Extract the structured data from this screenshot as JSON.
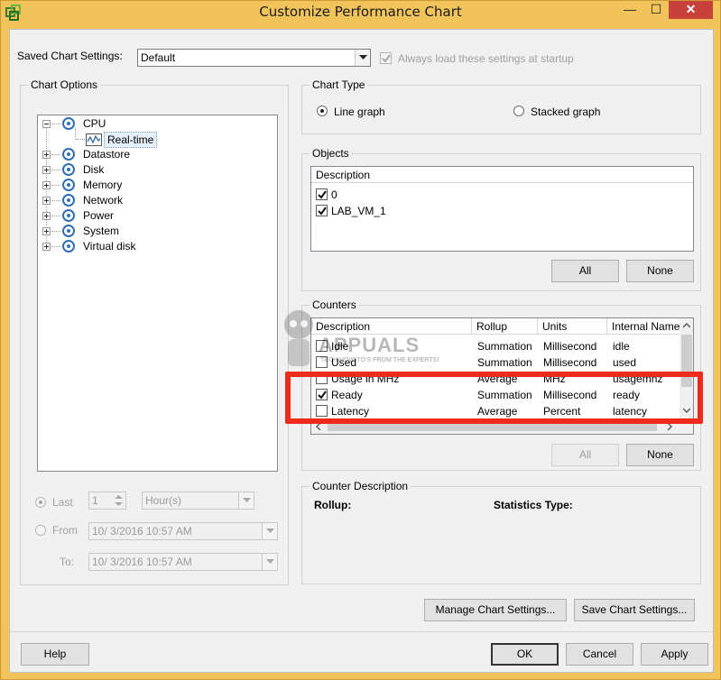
{
  "window": {
    "title": "Customize Performance Chart",
    "min_glyph": "—",
    "max_glyph": "☐",
    "close_glyph": "✕"
  },
  "saved_settings": {
    "label": "Saved Chart Settings:",
    "value": "Default",
    "always_load_label": "Always load these settings at startup",
    "always_load_checked": true
  },
  "chart_options": {
    "title": "Chart Options",
    "tree": [
      {
        "label": "CPU",
        "expanded": true
      },
      {
        "label": "Real-time",
        "child": true,
        "selected": true
      },
      {
        "label": "Datastore"
      },
      {
        "label": "Disk"
      },
      {
        "label": "Memory"
      },
      {
        "label": "Network"
      },
      {
        "label": "Power"
      },
      {
        "label": "System"
      },
      {
        "label": "Virtual disk"
      }
    ],
    "timespan": {
      "last_label": "Last",
      "last_value": "1",
      "last_unit": "Hour(s)",
      "from_label": "From",
      "from_value": "10/  3/2016 10:57 AM",
      "to_label": "To:",
      "to_value": "10/  3/2016 10:57 AM"
    }
  },
  "chart_type": {
    "title": "Chart Type",
    "line_label": "Line graph",
    "stacked_label": "Stacked graph",
    "selected": "line"
  },
  "objects": {
    "title": "Objects",
    "header": "Description",
    "items": [
      {
        "label": "0",
        "checked": true
      },
      {
        "label": "LAB_VM_1",
        "checked": true
      }
    ],
    "all_label": "All",
    "none_label": "None"
  },
  "counters": {
    "title": "Counters",
    "columns": [
      "Description",
      "Rollup",
      "Units",
      "Internal Name"
    ],
    "rows": [
      {
        "description": "Idle",
        "rollup": "Summation",
        "units": "Millisecond",
        "internal": "idle",
        "checked": false
      },
      {
        "description": "Used",
        "rollup": "Summation",
        "units": "Millisecond",
        "internal": "used",
        "checked": false
      },
      {
        "description": "Usage in MHz",
        "rollup": "Average",
        "units": "MHz",
        "internal": "usagemhz",
        "checked": false
      },
      {
        "description": "Ready",
        "rollup": "Summation",
        "units": "Millisecond",
        "internal": "ready",
        "checked": true
      },
      {
        "description": "Latency",
        "rollup": "Average",
        "units": "Percent",
        "internal": "latency",
        "checked": false
      }
    ],
    "all_label": "All",
    "none_label": "None"
  },
  "counter_description": {
    "title": "Counter Description",
    "rollup_label": "Rollup:",
    "stats_label": "Statistics Type:"
  },
  "buttons": {
    "manage": "Manage Chart Settings...",
    "save": "Save Chart Settings...",
    "help": "Help",
    "ok": "OK",
    "cancel": "Cancel",
    "apply": "Apply"
  },
  "watermark": {
    "brand": "APPUALS",
    "tagline": "TECH HOW-TO'S FROM THE EXPERTS!"
  },
  "colors": {
    "title_bar": "#f0c35b",
    "highlight": "#ee2a1b",
    "close_button": "#c7403a"
  }
}
